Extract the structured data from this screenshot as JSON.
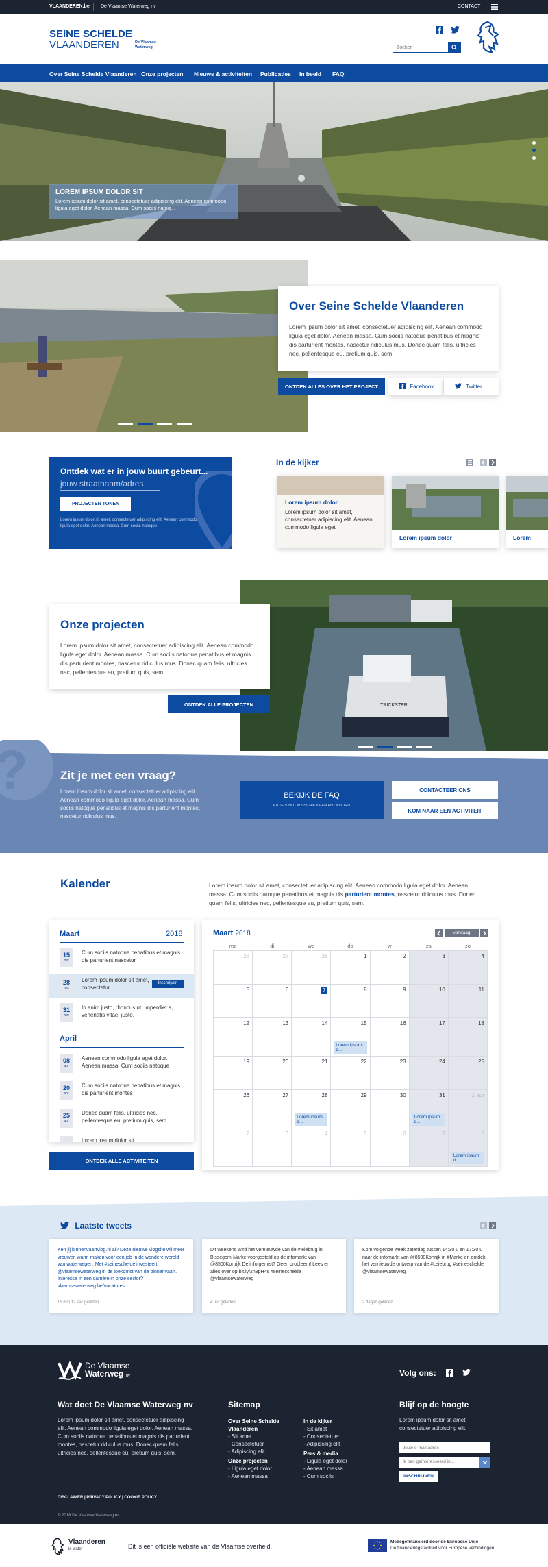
{
  "topbar": {
    "site": "VLAANDEREN.be",
    "org": "De Vlaamse Waterweg nv",
    "contact": "CONTACT"
  },
  "brand": {
    "line1": "SEINE SCHELDE",
    "line2": "VLAANDEREN",
    "partner": "De Vlaamse Waterweg",
    "search_placeholder": "Zoeken"
  },
  "nav": {
    "items": [
      "Over Seine Schelde Vlaanderen",
      "Onze projecten",
      "Nieuws & activiteiten",
      "Publicaties",
      "In beeld",
      "FAQ"
    ]
  },
  "hero": {
    "title": "LOREM IPSUM DOLOR SIT",
    "text": "Lorem ipsum dolor sit amet, consectetuer adipiscing elit. Aenean commodo ligula eget dolor. Aenean massa. Cum sociis natoq..."
  },
  "about": {
    "title": "Over Seine Schelde Vlaanderen",
    "text": "Lorem ipsum dolor sit amet, consectetuer adipiscing elit. Aenean commodo ligula eget dolor. Aenean massa. Cum sociis natoque penatibus et magnis dis parturient montes, nascetur ridiculus mus. Donec quam felis, ultricies nec, pellentesque eu, pretium quis, sem.",
    "cta": "ONTDEK ALLES OVER HET PROJECT",
    "facebook": "Facebook",
    "twitter": "Twitter"
  },
  "neighbourhood": {
    "title": "Ontdek wat er in jouw buurt gebeurt...",
    "input": "jouw straatnaam/adres",
    "button": "PROJECTEN TONEN",
    "note": "Lorem ipsum dolor sit amet, consectetuer adipiscing elit. Aenean commodo ligula eget dolor. Aenean massa. Cum sociis natoque"
  },
  "spotlight": {
    "title": "In de kijker",
    "card1": {
      "title": "Lorem ipsum dolor",
      "text": "Lorem ipsum dolor sit amet, consectetuer adipiscing elit. Aenean commodo ligula eget"
    },
    "card2": {
      "title": "Lorem ipsum dolor"
    },
    "card3": {
      "title": "Lorem"
    }
  },
  "projects": {
    "title": "Onze projecten",
    "text": "Lorem ipsum dolor sit amet, consectetuer adipiscing elit. Aenean commodo ligula eget dolor. Aenean massa. Cum sociis natoque penatibus et magnis dis parturient montes, nascetur ridiculus mus. Donec quam felis, ultricies nec, pellentesque eu, pretium quis, sem.",
    "cta": "ONTDEK ALLE PROJECTEN",
    "boat_label": "TRICKSTER"
  },
  "question": {
    "title": "Zit je met een vraag?",
    "text": "Lorem ipsum dolor sit amet, consectetuer adipiscing elit. Aenean commodo ligula eget dolor. Aenean massa. Cum sociis natoque penatibus et magnis dis parturient montes, nascetur ridiculus mus.",
    "faq": "BEKIJK DE FAQ",
    "faq_sub": "EN JE VINDT MISSCHIEN EEN ANTWOORD",
    "contact": "CONTACTEER ONS",
    "activity": "KOM NAAR EEN ACTIVITEIT"
  },
  "calendar": {
    "title": "Kalender",
    "intro_a": "Lorem ipsum dolor sit amet, consectetuer adipiscing elit. Aenean commodo ligula eget dolor. Aenean massa. Cum sociis natoque penatibus et magnis dis ",
    "intro_bold": "parturient montes",
    "intro_b": ", nascetur ridiculus mus. Donec quam felis, ultricies nec, pellentesque eu, pretium quis, sem.",
    "list_month1": "Maart",
    "list_year": "2018",
    "list_month2": "April",
    "events_march": [
      {
        "day": "15",
        "mon": "mrt",
        "text": "Cum sociis natoque penatibus et magnis dis parturient nascetur"
      },
      {
        "day": "28",
        "mon": "mrt",
        "text": "Lorem ipsum dolor sit amet, consectetur",
        "action": "Inschrijven"
      },
      {
        "day": "31",
        "mon": "mrt",
        "text": "In enim justo, rhoncus ut, imperdiet a, venenatis vitae, justo."
      }
    ],
    "events_april": [
      {
        "day": "08",
        "mon": "apr",
        "text": "Aenean commodo ligula eget dolor. Aenean massa. Cum sociis natoque"
      },
      {
        "day": "20",
        "mon": "apr",
        "text": "Cum sociis natoque penatibus et magnis dis parturient montes"
      },
      {
        "day": "25",
        "mon": "apr",
        "text": "Donec quam felis, ultricies nec, pellentesque eu, pretium quis, sem."
      },
      {
        "day": "",
        "mon": "",
        "text": "Lorem ipsum dolor sit"
      }
    ],
    "list_cta": "ONTDEK ALLE ACTIVITEITEN",
    "grid_month": "Maart",
    "grid_year": "2018",
    "today_btn": "vandaag",
    "weekdays": [
      "ma",
      "di",
      "wo",
      "do",
      "vr",
      "za",
      "zo"
    ],
    "weeks": [
      [
        {
          "d": "26",
          "m": true
        },
        {
          "d": "27",
          "m": true
        },
        {
          "d": "28",
          "m": true
        },
        {
          "d": "1"
        },
        {
          "d": "2"
        },
        {
          "d": "3"
        },
        {
          "d": "4"
        }
      ],
      [
        {
          "d": "5"
        },
        {
          "d": "6"
        },
        {
          "d": "7",
          "today": true
        },
        {
          "d": "8"
        },
        {
          "d": "9"
        },
        {
          "d": "10"
        },
        {
          "d": "11"
        }
      ],
      [
        {
          "d": "12"
        },
        {
          "d": "13"
        },
        {
          "d": "14"
        },
        {
          "d": "15",
          "e": "Lorem ipsum d..."
        },
        {
          "d": "16"
        },
        {
          "d": "17"
        },
        {
          "d": "18"
        }
      ],
      [
        {
          "d": "19"
        },
        {
          "d": "20"
        },
        {
          "d": "21"
        },
        {
          "d": "22"
        },
        {
          "d": "23"
        },
        {
          "d": "24"
        },
        {
          "d": "25"
        }
      ],
      [
        {
          "d": "26"
        },
        {
          "d": "27"
        },
        {
          "d": "28",
          "e": "Lorem ipsum d..."
        },
        {
          "d": "29"
        },
        {
          "d": "30"
        },
        {
          "d": "31",
          "e": "Lorem ipsum d..."
        },
        {
          "d": "1 apr",
          "m": true
        }
      ],
      [
        {
          "d": "2",
          "m": true
        },
        {
          "d": "3",
          "m": true
        },
        {
          "d": "4",
          "m": true
        },
        {
          "d": "5",
          "m": true
        },
        {
          "d": "6",
          "m": true
        },
        {
          "d": "7",
          "m": true
        },
        {
          "d": "8",
          "m": true,
          "e": "Lorem ipsum d..."
        }
      ]
    ]
  },
  "tweets": {
    "title": "Laatste tweets",
    "items": [
      {
        "text": "Ken jij binnenvaartvlog.nl al? Deze nieuwe vlogsite wil meer vrouwen warm maken voor een job in de wondere wereld van waterwegen. Met #seineschelde investeert @vlaamsewaterweg in de toekomst van de binnenvaart. Interesse in een carrière in onze sector? vlaamsewaterweg.be/vacatures",
        "time": "15 min 12 sec geleden"
      },
      {
        "text": "Dit weekend wird het vernieuwde van de #leiebrug in Bissegem-Marke voorgesteld op de infomarkt van @8500Kortrijk De info gemist? Geen probleem! Lees er alles over op bit.ly/2n8pH4s #seineschelde @vlaamsewaterweg",
        "time": "4 uur geleden"
      },
      {
        "text": "Kom volgende week zaterdag tussen 14:30 u en 17:30 u naar de infomarkt van @8500Kortrijk in #Marke en ontdek het vernieuwde ontwerp van de #Leiebrug #seineschelde @vlaamsewaterweg",
        "time": "2 dagen geleden"
      }
    ]
  },
  "footer": {
    "logo_line1": "De Vlaamse",
    "logo_line2": "Waterweg",
    "logo_nv": "nv",
    "follow": "Volg ons:",
    "about_title": "Wat doet De Vlaamse Waterweg nv",
    "about_text": "Lorem ipsum dolor sit amet, consectetuer adipiscing elit. Aenean commodo ligula eget dolor. Aenean massa. Cum sociis natoque penatibus et magnis dis parturient montes, nascetur ridiculus mus. Donec quam felis, ultricies nec, pellentesque eu, pretium quis, sem.",
    "sitemap_title": "Sitemap",
    "sm_group1": "Over Seine Schelde Vlaanderen",
    "sm_g1_links": [
      "Sit amet",
      "Consectetuer",
      "Adipiscing elit"
    ],
    "sm_group2": "Onze projecten",
    "sm_g2_links": [
      "Ligula eget dolor",
      "Aenean massa"
    ],
    "sm_group3": "In de kijker",
    "sm_g3_links": [
      "Sit amet",
      "Consectetuer",
      "Adipiscing elit"
    ],
    "sm_group4": "Pers & media",
    "sm_g4_links": [
      "Ligula eget dolor",
      "Aenean massa",
      "Cum sociis"
    ],
    "news_title": "Blijf op de hoogte",
    "news_text": "Lorem ipsum dolor sit amet, consectetuer adipiscing elit.",
    "email_placeholder": "Jouw e-mail adres",
    "interest_placeholder": "Ik ben geïnteresseerd in...",
    "subscribe": "INSCHRIJVEN",
    "legal": "DISCLAIMER | PRIVACY POLICY | COOKIE POLICY",
    "copyright": "© 2018 De Vlaamse Waterweg nv"
  },
  "bottom": {
    "vl_name": "Vlaanderen",
    "vl_sub": "is water",
    "official": "Dit is een officiële website van de Vlaamse overheid.",
    "eu_line1": "Medegefinancierd door de Europese Unie",
    "eu_line2": "De financieringsfaciliteit voor Europese verbindingen"
  },
  "colors": {
    "primary": "#0d4ba0",
    "dark": "#1c2331",
    "light_blue": "#dce8f4",
    "question_bg": "#6a86b4"
  }
}
